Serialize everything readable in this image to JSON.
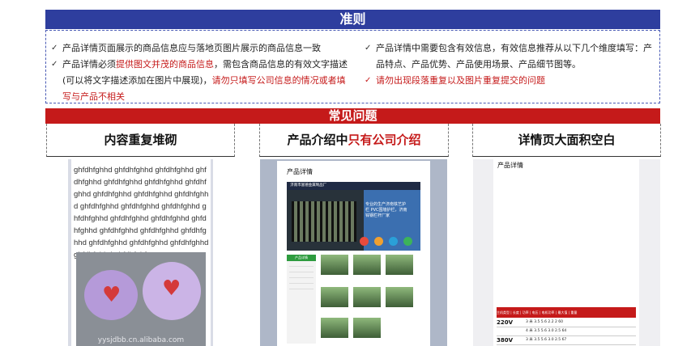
{
  "rules": {
    "title": "准则",
    "left_items": [
      {
        "check": "✓",
        "parts": [
          {
            "text": "产品详情页面展示的商品信息应与落地页图片展示的商品信息一致",
            "red": false
          }
        ]
      },
      {
        "check": "✓",
        "parts": [
          {
            "text": "产品详情必须",
            "red": false
          },
          {
            "text": "提供图文并茂的商品信息",
            "red": true
          },
          {
            "text": "，需包含商品信息的有效文字描述(可以将文字描述添加在图片中展现)，",
            "red": false
          },
          {
            "text": "请勿只填写公司信息的情况或者填写与产品不相关",
            "red": true
          }
        ]
      }
    ],
    "right_items": [
      {
        "check": "✓",
        "red_check": false,
        "parts": [
          {
            "text": "产品详情中需要包含有效信息，有效信息推荐从以下几个维度填写：产品特点、产品优势、产品使用场景、产品细节图等。",
            "red": false
          }
        ]
      },
      {
        "check": "✓",
        "red_check": true,
        "parts": [
          {
            "text": "请勿出现段落重复以及图片重复提交的问题",
            "red": true
          }
        ]
      }
    ]
  },
  "faq": {
    "title": "常见问题",
    "card1": {
      "title": "内容重复堆砌",
      "filler": "ghfdhfghhd ghfdhfghhd ghfdhfghhd ghfdhfghhd ghfdhfghhd ghfdhfghhd ghfdhfghhd ghfdhfghhd ghfdhfghhd ghfdhfghhd ghfdhfghhd ghfdhfghhd ghfdhfghhd ghfdhfghhd ghfdhfghhd ghfdhfghhd ghfdhfghhd ghfdhfghhd ghfdhfghhd ghfdhfghhd ghfdhfghhd ghfdhfghhd ghfdhfghhd ghfdhfghhd ghfdhfghf",
      "img_caption": "yysjdbb.cn.alibaba.com"
    },
    "card2": {
      "title_normal": "产品介绍中",
      "title_red": "只有公司介绍",
      "page_title": "产品详情",
      "header_text": "济南市富德金属制品厂",
      "hero_text": "专业的生产济南铁艺护栏 PVC围墙护栏，济南锌钢栏杆厂家",
      "side_header": "产品详情"
    },
    "card3": {
      "title": "详情页大面积空白",
      "page_title": "产品详情",
      "table_header": "主机类型 | 长度 | 功率 | 电压 | 电机功率 | 最大值 | 重量",
      "rows": [
        {
          "v": "220V",
          "vals": "3 米   3.5   5.6   2.2   2   60"
        },
        {
          "v": "",
          "vals": "4 米   3.5   5.6   3.0   2.5   64"
        },
        {
          "v": "380V",
          "vals": "3 米   3.5   5.6   3.0   2.5   67"
        }
      ]
    }
  },
  "colors": {
    "rules_banner": "#2e3e9e",
    "faq_banner": "#c51a1a",
    "accent_red": "#c51a1a"
  }
}
